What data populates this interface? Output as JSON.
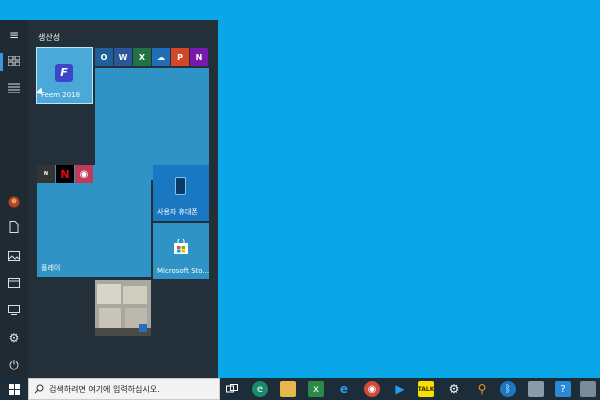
{
  "start_menu": {
    "group_title": "생산성",
    "tiles": {
      "feem_label": "Feem 2018",
      "play_label": "플레이",
      "phone_label": "사용자 휴대폰",
      "store_label": "Microsoft Sto..."
    },
    "mini_tiles": [
      "outlook-icon",
      "word-icon",
      "excel-icon",
      "onedrive-icon",
      "powerpoint-icon",
      "onenote-icon"
    ],
    "play_sub": [
      "nintendo-icon",
      "netflix-icon",
      "camera-icon"
    ]
  },
  "taskbar": {
    "search_placeholder": "검색하려면 여기에 입력하십시오.",
    "icons": [
      "task-view-icon",
      "edge-icon",
      "file-explorer-icon",
      "excel-app-icon",
      "ie-icon",
      "chrome-icon",
      "media-player-icon",
      "kakaotalk-icon",
      "settings-gear-icon",
      "search-app-icon",
      "bluetooth-icon",
      "remote-desktop-icon",
      "help-icon",
      "app-icon"
    ]
  },
  "colors": {
    "desktop": "#0aa7e8",
    "start_bg": "#233039",
    "tile_blue": "#2f93c5",
    "taskbar": "#1c2c38"
  }
}
